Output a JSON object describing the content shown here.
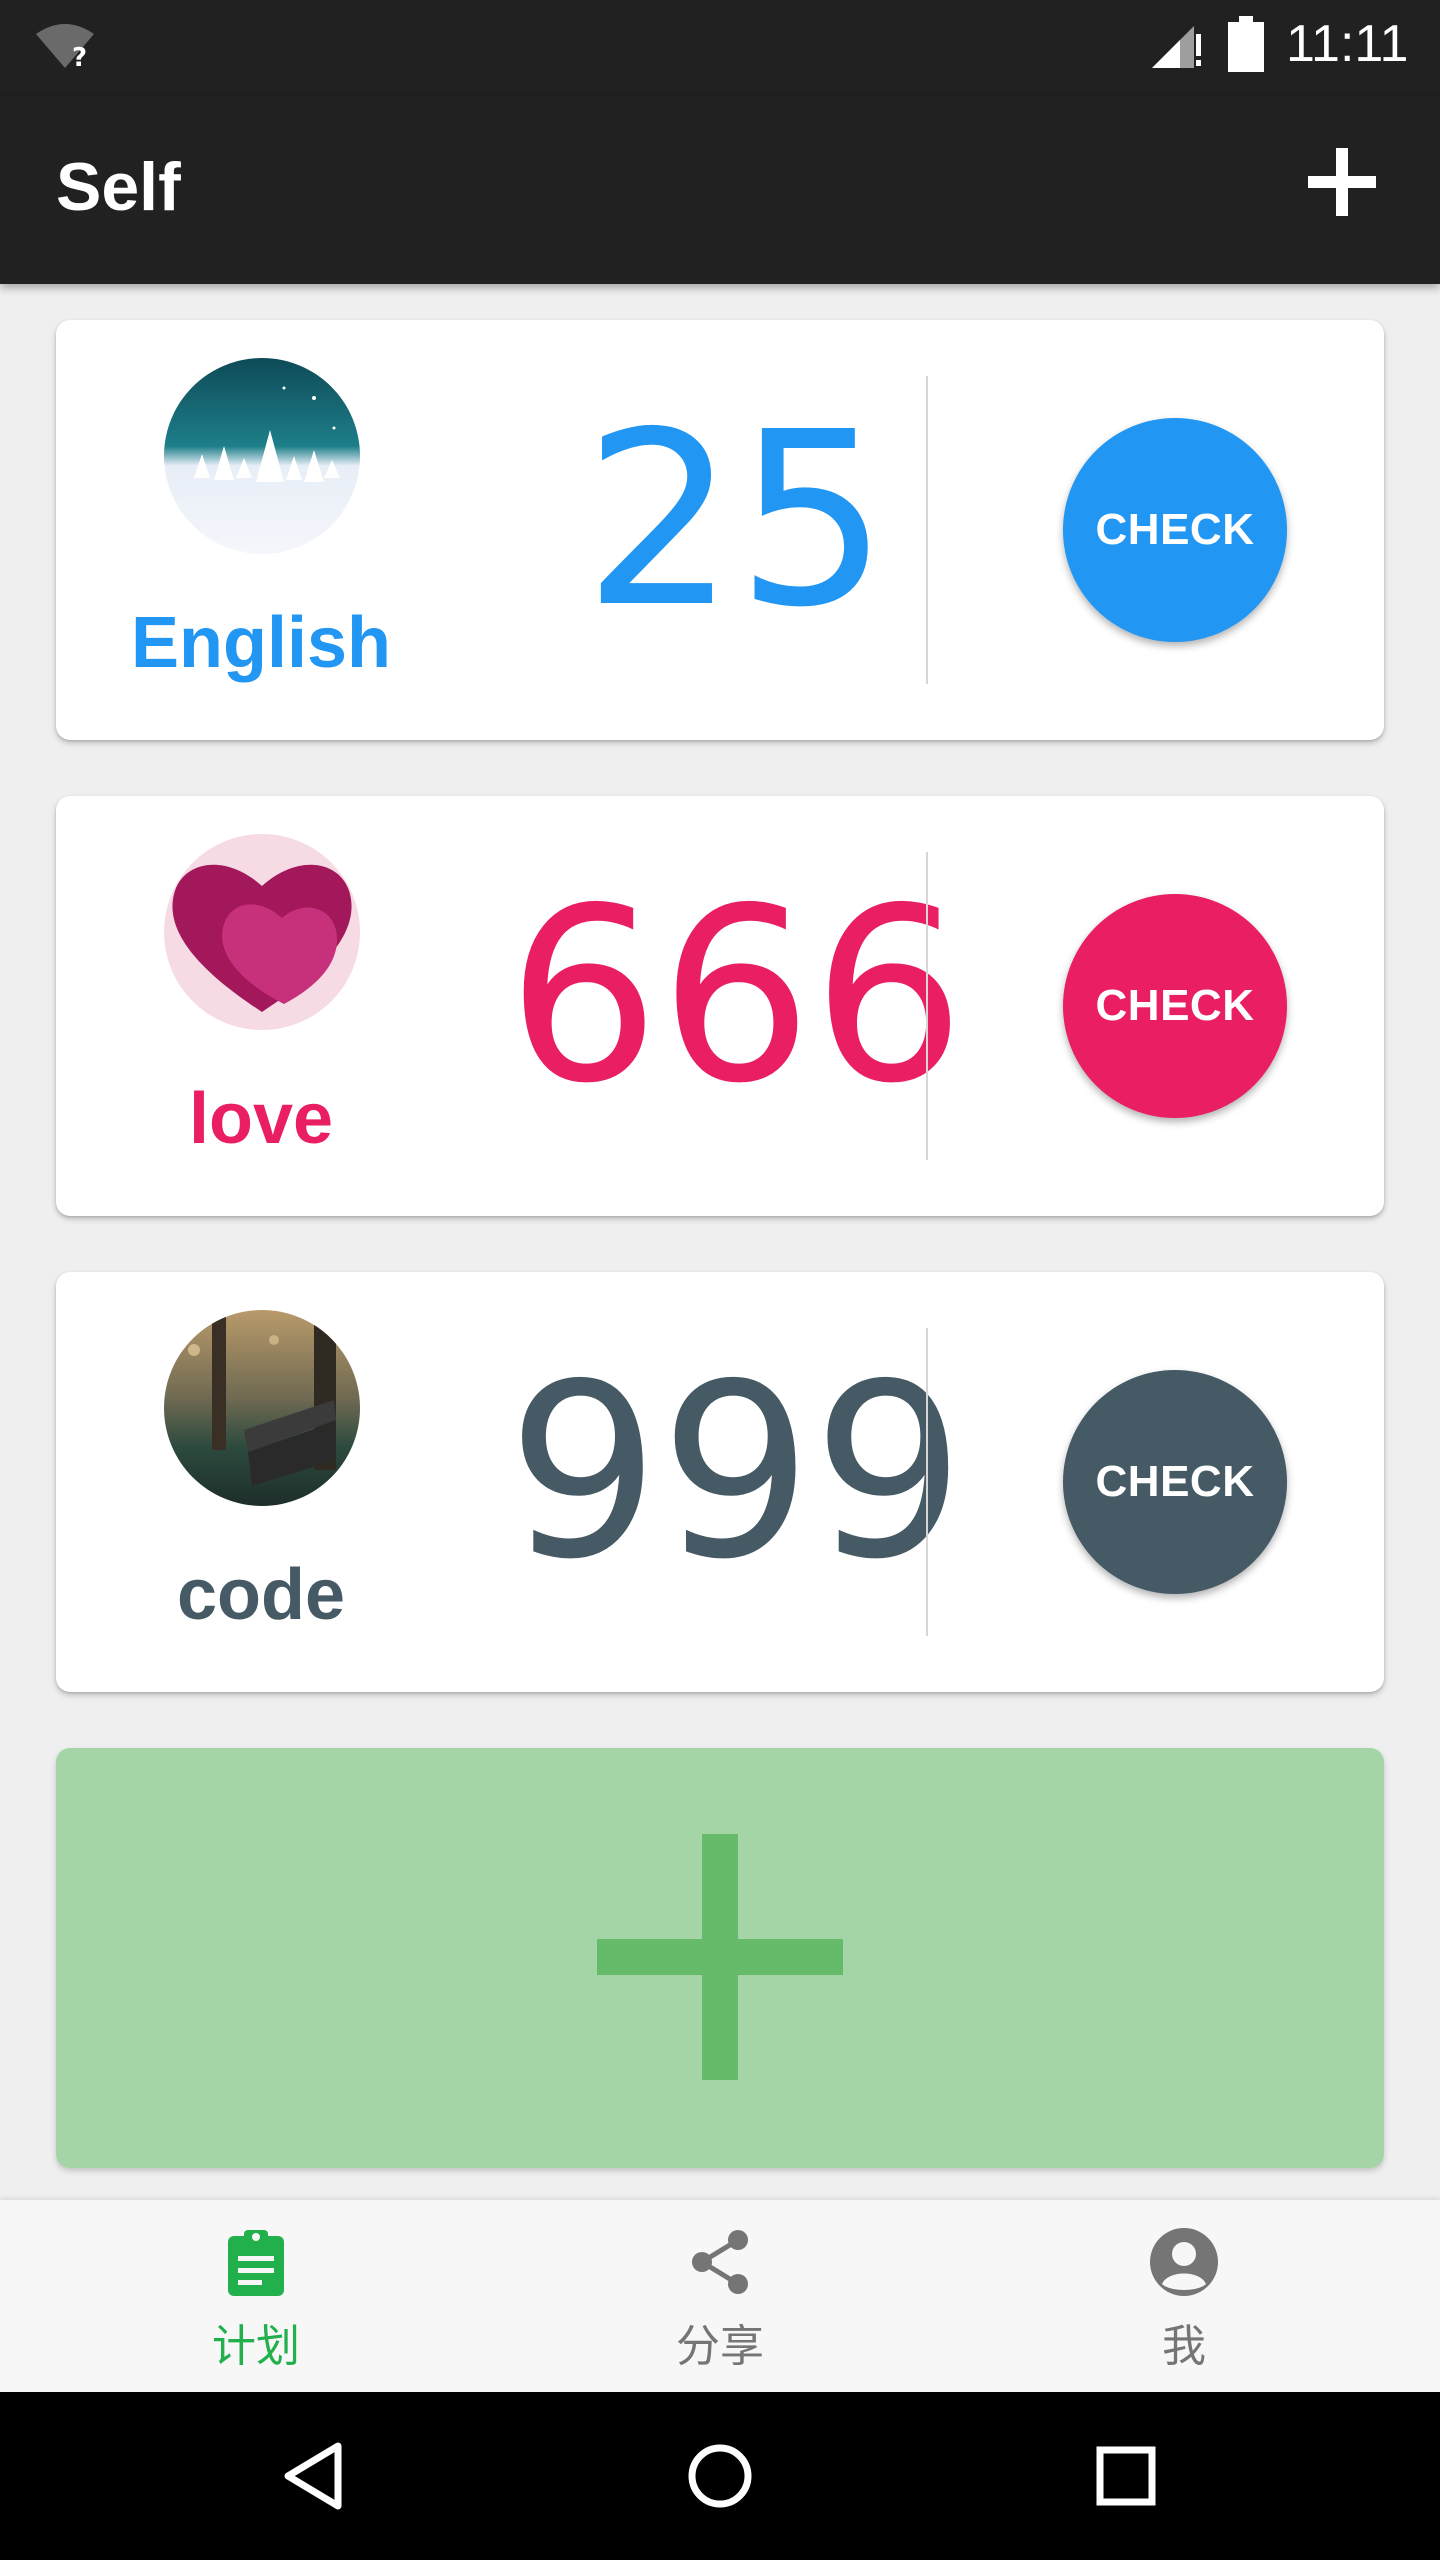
{
  "status_bar": {
    "time": "11:11"
  },
  "app_bar": {
    "title": "Self"
  },
  "habits": [
    {
      "name": "English",
      "count": "25",
      "check_label": "CHECK",
      "color": "#2196f3"
    },
    {
      "name": "love",
      "count": "666",
      "check_label": "CHECK",
      "color": "#e91e63"
    },
    {
      "name": "code",
      "count": "999",
      "check_label": "CHECK",
      "color": "#455a64"
    }
  ],
  "bottom_nav": {
    "items": [
      {
        "label": "计划",
        "icon": "clipboard-icon",
        "active": true,
        "color": "#21b04b"
      },
      {
        "label": "分享",
        "icon": "share-icon",
        "active": false,
        "color": "#757575"
      },
      {
        "label": "我",
        "icon": "account-circle-icon",
        "active": false,
        "color": "#757575"
      }
    ]
  }
}
